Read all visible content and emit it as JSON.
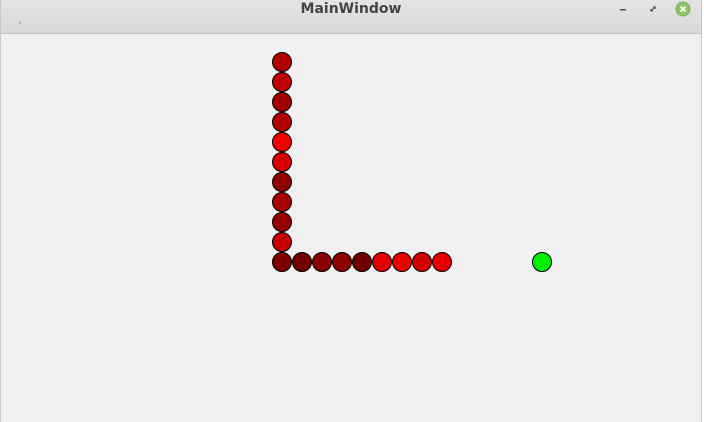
{
  "window": {
    "title": "MainWindow",
    "controls": [
      {
        "name": "minimize",
        "icon": "minimize-icon"
      },
      {
        "name": "restore",
        "icon": "restore-icon"
      },
      {
        "name": "close",
        "icon": "close-icon"
      }
    ]
  },
  "board": {
    "cell_size_units": 20,
    "snake": [
      {
        "col": 0,
        "row": 0,
        "color": "#b00000"
      },
      {
        "col": 0,
        "row": 1,
        "color": "#c00000"
      },
      {
        "col": 0,
        "row": 2,
        "color": "#a00000"
      },
      {
        "col": 0,
        "row": 3,
        "color": "#b00000"
      },
      {
        "col": 0,
        "row": 4,
        "color": "#f00000"
      },
      {
        "col": 0,
        "row": 5,
        "color": "#d60000"
      },
      {
        "col": 0,
        "row": 6,
        "color": "#900000"
      },
      {
        "col": 0,
        "row": 7,
        "color": "#a60000"
      },
      {
        "col": 0,
        "row": 8,
        "color": "#960000"
      },
      {
        "col": 0,
        "row": 9,
        "color": "#c40000"
      },
      {
        "col": 0,
        "row": 10,
        "color": "#800000"
      },
      {
        "col": 1,
        "row": 10,
        "color": "#700000"
      },
      {
        "col": 2,
        "row": 10,
        "color": "#860000"
      },
      {
        "col": 3,
        "row": 10,
        "color": "#8c0000"
      },
      {
        "col": 4,
        "row": 10,
        "color": "#6e0000"
      },
      {
        "col": 5,
        "row": 10,
        "color": "#e00000"
      },
      {
        "col": 6,
        "row": 10,
        "color": "#ea0000"
      },
      {
        "col": 7,
        "row": 10,
        "color": "#d00000"
      },
      {
        "col": 8,
        "row": 10,
        "color": "#e80000"
      }
    ],
    "food": {
      "col": 13,
      "row": 10,
      "color": "#00ee00"
    },
    "outline_color": "#000000",
    "background_color": "#f0f0f0"
  }
}
